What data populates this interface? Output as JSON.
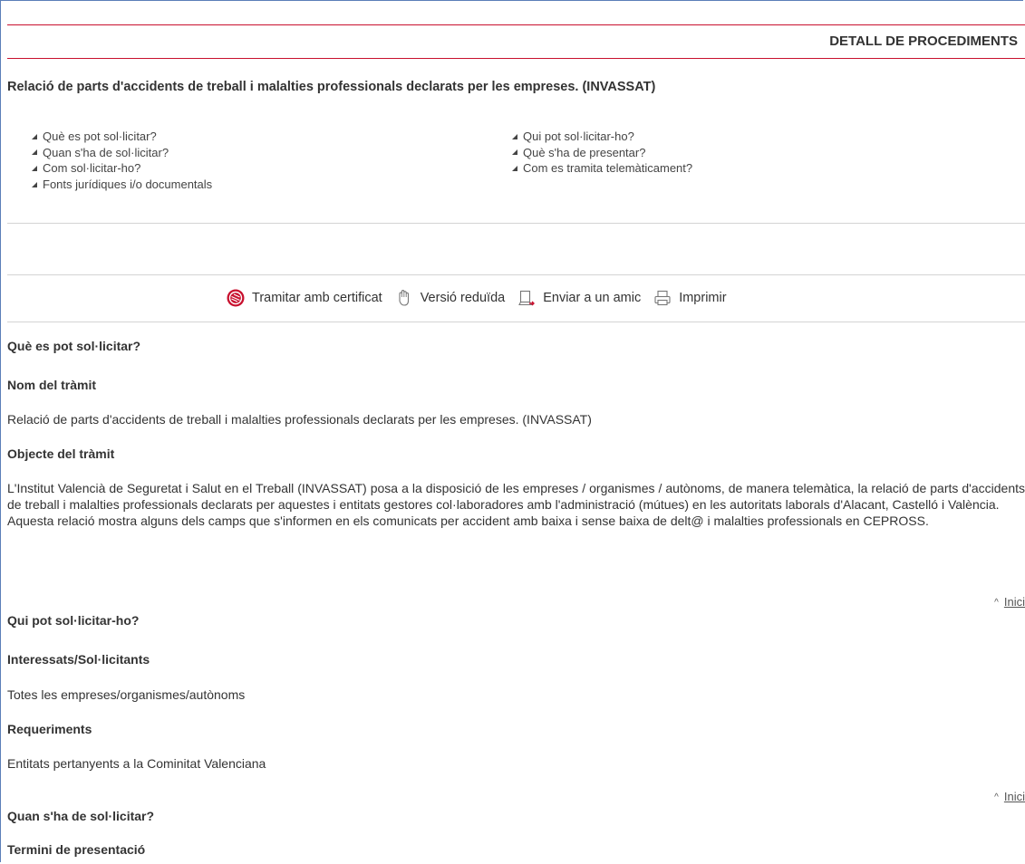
{
  "header": {
    "title": "DETALL DE PROCEDIMENTS"
  },
  "procedure": {
    "title": "Relació de parts d'accidents de treball i malalties professionals declarats per les empreses. (INVASSAT)"
  },
  "index": {
    "left": [
      "Què es pot sol·licitar?",
      "Quan s'ha de sol·licitar?",
      "Com sol·licitar-ho?",
      "Fonts jurídiques i/o documentals"
    ],
    "right": [
      "Qui pot sol·licitar-ho?",
      "Què s'ha de presentar?",
      "Com es tramita telemàticament?"
    ]
  },
  "toolbar": {
    "certificate": "Tramitar amb certificat",
    "reduced": "Versió reduïda",
    "send_friend": "Enviar a un amic",
    "print": "Imprimir"
  },
  "colors": {
    "accent_red": "#c8102e",
    "frame_blue": "#5b7fb8"
  },
  "sections": {
    "what": {
      "heading": "Què es pot sol·licitar?",
      "name_label": "Nom del tràmit",
      "name_value": "Relació de parts d'accidents de treball i malalties professionals declarats per les empreses. (INVASSAT)",
      "object_label": "Objecte del tràmit",
      "object_p1": "L'Institut Valencià de Seguretat i Salut en el Treball (INVASSAT) posa a la disposició de les empreses / organismes / autònoms, de manera telemàtica, la relació de parts d'accidents de treball i malalties professionals declarats per aquestes i entitats gestores col·laboradores amb l'administració (mútues) en les autoritats laborals d'Alacant, Castelló i València.",
      "object_p2": "Aquesta relació mostra alguns dels camps que s'informen en els comunicats per accident amb baixa i sense baixa de delt@ i malalties professionals en CEPROSS."
    },
    "who": {
      "heading": "Qui pot sol·licitar-ho?",
      "interested_label": "Interessats/Sol·licitants",
      "interested_value": "Totes les empreses/organismes/autònoms",
      "req_label": "Requeriments",
      "req_value": "Entitats pertanyents a la Cominitat Valenciana"
    },
    "when": {
      "heading": "Quan s'ha de sol·licitar?",
      "deadline_label": "Termini de presentació"
    }
  },
  "back_to_top": "Inici"
}
